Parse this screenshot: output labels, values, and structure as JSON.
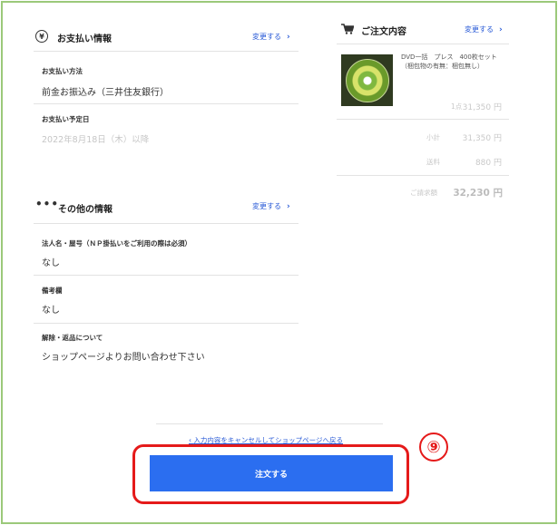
{
  "payment": {
    "title": "お支払い情報",
    "change_label": "変更する",
    "method_label": "お支払い方法",
    "method_value": "前金お振込み（三井住友銀行）",
    "due_label": "お支払い予定日",
    "due_value": "2022年8月18日（木）以降"
  },
  "other": {
    "title": "その他の情報",
    "change_label": "変更する",
    "fields": [
      {
        "label": "法人名・屋号（ＮＰ掛払いをご利用の際は必須）",
        "value": "なし"
      },
      {
        "label": "備考欄",
        "value": "なし"
      },
      {
        "label": "解除・返品について",
        "value": "ショップページよりお問い合わせ下さい"
      }
    ]
  },
  "order": {
    "title": "ご注文内容",
    "change_label": "変更する",
    "product_name": "DVD一括　プレス　400枚セット（梱包物の有無：梱包無し）",
    "item_qty": "1点",
    "item_price": "31,350 円",
    "subtotal_label": "小計",
    "subtotal_value": "31,350 円",
    "shipping_label": "送料",
    "shipping_value": "880 円",
    "total_label": "ご請求額",
    "total_value": "32,230 円"
  },
  "footer": {
    "cancel_link": "入力内容をキャンセルしてショップページへ戻る",
    "order_button": "注文する",
    "step_number": "⑨"
  },
  "colors": {
    "accent_blue": "#2b6ef0",
    "highlight_red": "#e51a1a",
    "frame_green": "#9bc97a"
  }
}
